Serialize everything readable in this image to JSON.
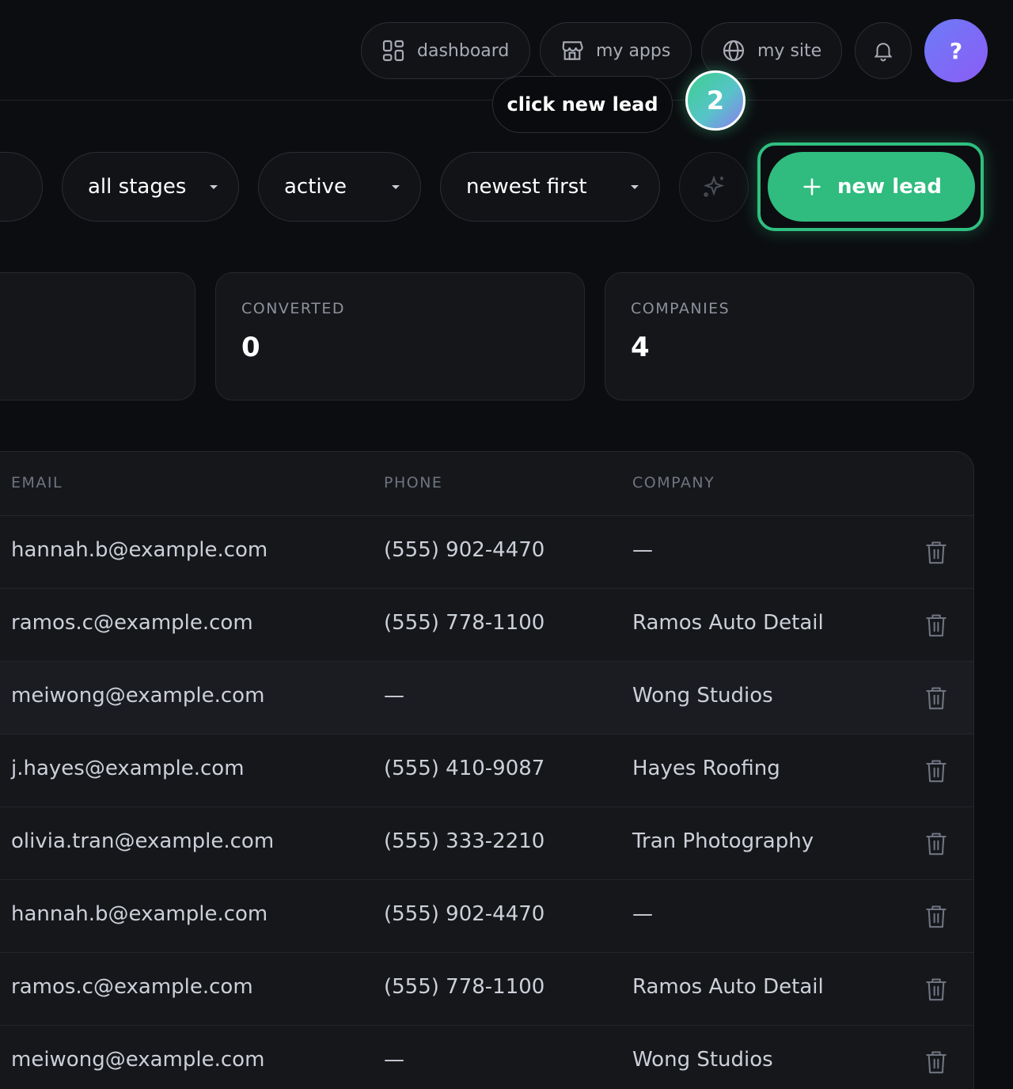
{
  "nav": {
    "dashboard": "dashboard",
    "my_apps": "my apps",
    "my_site": "my site",
    "help": "?"
  },
  "tour": {
    "tooltip": "click new lead",
    "step": "2"
  },
  "filters": {
    "stage": "all stages",
    "status": "active",
    "sort": "newest first"
  },
  "actions": {
    "new_lead": "new lead"
  },
  "stats": [
    {
      "label": "CONVERTED",
      "value": "0"
    },
    {
      "label": "COMPANIES",
      "value": "4"
    }
  ],
  "table": {
    "columns": [
      "EMAIL",
      "PHONE",
      "COMPANY"
    ],
    "rows": [
      {
        "email": "hannah.b@example.com",
        "phone": "(555) 902-4470",
        "company": "—"
      },
      {
        "email": "ramos.c@example.com",
        "phone": "(555) 778-1100",
        "company": "Ramos Auto Detail"
      },
      {
        "email": "meiwong@example.com",
        "phone": "—",
        "company": "Wong Studios"
      },
      {
        "email": "j.hayes@example.com",
        "phone": "(555) 410-9087",
        "company": "Hayes Roofing"
      },
      {
        "email": "olivia.tran@example.com",
        "phone": "(555) 333-2210",
        "company": "Tran Photography"
      },
      {
        "email": "hannah.b@example.com",
        "phone": "(555) 902-4470",
        "company": "—"
      },
      {
        "email": "ramos.c@example.com",
        "phone": "(555) 778-1100",
        "company": "Ramos Auto Detail"
      },
      {
        "email": "meiwong@example.com",
        "phone": "—",
        "company": "Wong Studios"
      }
    ]
  },
  "colors": {
    "background": "#0c0d10",
    "accent_green": "#2fbc7e",
    "help_purple": "#7c6cf6"
  },
  "icons": {
    "dashboard": "grid-icon",
    "my_apps": "storefront-icon",
    "my_site": "globe-icon",
    "notifications": "bell-icon",
    "ai": "sparkle-icon",
    "new_lead": "plus-icon",
    "row_action": "trash-icon"
  }
}
